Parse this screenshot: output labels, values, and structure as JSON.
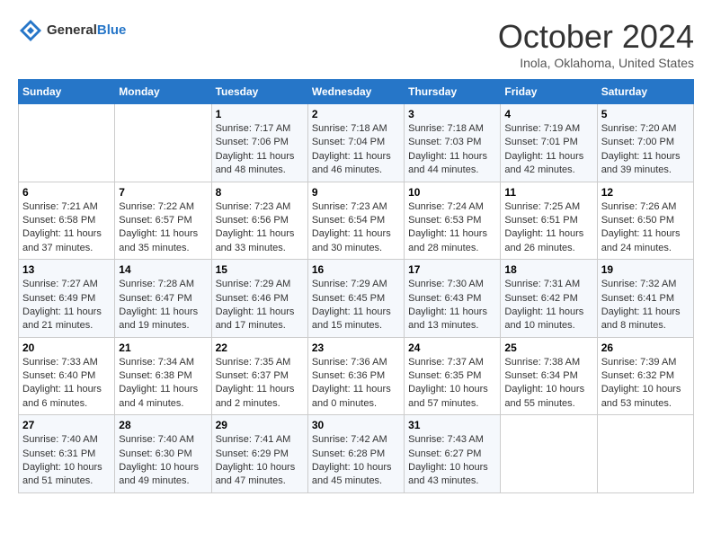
{
  "header": {
    "logo_general": "General",
    "logo_blue": "Blue",
    "month": "October 2024",
    "location": "Inola, Oklahoma, United States"
  },
  "columns": [
    "Sunday",
    "Monday",
    "Tuesday",
    "Wednesday",
    "Thursday",
    "Friday",
    "Saturday"
  ],
  "weeks": [
    [
      {
        "day": "",
        "sunrise": "",
        "sunset": "",
        "daylight": ""
      },
      {
        "day": "",
        "sunrise": "",
        "sunset": "",
        "daylight": ""
      },
      {
        "day": "1",
        "sunrise": "Sunrise: 7:17 AM",
        "sunset": "Sunset: 7:06 PM",
        "daylight": "Daylight: 11 hours and 48 minutes."
      },
      {
        "day": "2",
        "sunrise": "Sunrise: 7:18 AM",
        "sunset": "Sunset: 7:04 PM",
        "daylight": "Daylight: 11 hours and 46 minutes."
      },
      {
        "day": "3",
        "sunrise": "Sunrise: 7:18 AM",
        "sunset": "Sunset: 7:03 PM",
        "daylight": "Daylight: 11 hours and 44 minutes."
      },
      {
        "day": "4",
        "sunrise": "Sunrise: 7:19 AM",
        "sunset": "Sunset: 7:01 PM",
        "daylight": "Daylight: 11 hours and 42 minutes."
      },
      {
        "day": "5",
        "sunrise": "Sunrise: 7:20 AM",
        "sunset": "Sunset: 7:00 PM",
        "daylight": "Daylight: 11 hours and 39 minutes."
      }
    ],
    [
      {
        "day": "6",
        "sunrise": "Sunrise: 7:21 AM",
        "sunset": "Sunset: 6:58 PM",
        "daylight": "Daylight: 11 hours and 37 minutes."
      },
      {
        "day": "7",
        "sunrise": "Sunrise: 7:22 AM",
        "sunset": "Sunset: 6:57 PM",
        "daylight": "Daylight: 11 hours and 35 minutes."
      },
      {
        "day": "8",
        "sunrise": "Sunrise: 7:23 AM",
        "sunset": "Sunset: 6:56 PM",
        "daylight": "Daylight: 11 hours and 33 minutes."
      },
      {
        "day": "9",
        "sunrise": "Sunrise: 7:23 AM",
        "sunset": "Sunset: 6:54 PM",
        "daylight": "Daylight: 11 hours and 30 minutes."
      },
      {
        "day": "10",
        "sunrise": "Sunrise: 7:24 AM",
        "sunset": "Sunset: 6:53 PM",
        "daylight": "Daylight: 11 hours and 28 minutes."
      },
      {
        "day": "11",
        "sunrise": "Sunrise: 7:25 AM",
        "sunset": "Sunset: 6:51 PM",
        "daylight": "Daylight: 11 hours and 26 minutes."
      },
      {
        "day": "12",
        "sunrise": "Sunrise: 7:26 AM",
        "sunset": "Sunset: 6:50 PM",
        "daylight": "Daylight: 11 hours and 24 minutes."
      }
    ],
    [
      {
        "day": "13",
        "sunrise": "Sunrise: 7:27 AM",
        "sunset": "Sunset: 6:49 PM",
        "daylight": "Daylight: 11 hours and 21 minutes."
      },
      {
        "day": "14",
        "sunrise": "Sunrise: 7:28 AM",
        "sunset": "Sunset: 6:47 PM",
        "daylight": "Daylight: 11 hours and 19 minutes."
      },
      {
        "day": "15",
        "sunrise": "Sunrise: 7:29 AM",
        "sunset": "Sunset: 6:46 PM",
        "daylight": "Daylight: 11 hours and 17 minutes."
      },
      {
        "day": "16",
        "sunrise": "Sunrise: 7:29 AM",
        "sunset": "Sunset: 6:45 PM",
        "daylight": "Daylight: 11 hours and 15 minutes."
      },
      {
        "day": "17",
        "sunrise": "Sunrise: 7:30 AM",
        "sunset": "Sunset: 6:43 PM",
        "daylight": "Daylight: 11 hours and 13 minutes."
      },
      {
        "day": "18",
        "sunrise": "Sunrise: 7:31 AM",
        "sunset": "Sunset: 6:42 PM",
        "daylight": "Daylight: 11 hours and 10 minutes."
      },
      {
        "day": "19",
        "sunrise": "Sunrise: 7:32 AM",
        "sunset": "Sunset: 6:41 PM",
        "daylight": "Daylight: 11 hours and 8 minutes."
      }
    ],
    [
      {
        "day": "20",
        "sunrise": "Sunrise: 7:33 AM",
        "sunset": "Sunset: 6:40 PM",
        "daylight": "Daylight: 11 hours and 6 minutes."
      },
      {
        "day": "21",
        "sunrise": "Sunrise: 7:34 AM",
        "sunset": "Sunset: 6:38 PM",
        "daylight": "Daylight: 11 hours and 4 minutes."
      },
      {
        "day": "22",
        "sunrise": "Sunrise: 7:35 AM",
        "sunset": "Sunset: 6:37 PM",
        "daylight": "Daylight: 11 hours and 2 minutes."
      },
      {
        "day": "23",
        "sunrise": "Sunrise: 7:36 AM",
        "sunset": "Sunset: 6:36 PM",
        "daylight": "Daylight: 11 hours and 0 minutes."
      },
      {
        "day": "24",
        "sunrise": "Sunrise: 7:37 AM",
        "sunset": "Sunset: 6:35 PM",
        "daylight": "Daylight: 10 hours and 57 minutes."
      },
      {
        "day": "25",
        "sunrise": "Sunrise: 7:38 AM",
        "sunset": "Sunset: 6:34 PM",
        "daylight": "Daylight: 10 hours and 55 minutes."
      },
      {
        "day": "26",
        "sunrise": "Sunrise: 7:39 AM",
        "sunset": "Sunset: 6:32 PM",
        "daylight": "Daylight: 10 hours and 53 minutes."
      }
    ],
    [
      {
        "day": "27",
        "sunrise": "Sunrise: 7:40 AM",
        "sunset": "Sunset: 6:31 PM",
        "daylight": "Daylight: 10 hours and 51 minutes."
      },
      {
        "day": "28",
        "sunrise": "Sunrise: 7:40 AM",
        "sunset": "Sunset: 6:30 PM",
        "daylight": "Daylight: 10 hours and 49 minutes."
      },
      {
        "day": "29",
        "sunrise": "Sunrise: 7:41 AM",
        "sunset": "Sunset: 6:29 PM",
        "daylight": "Daylight: 10 hours and 47 minutes."
      },
      {
        "day": "30",
        "sunrise": "Sunrise: 7:42 AM",
        "sunset": "Sunset: 6:28 PM",
        "daylight": "Daylight: 10 hours and 45 minutes."
      },
      {
        "day": "31",
        "sunrise": "Sunrise: 7:43 AM",
        "sunset": "Sunset: 6:27 PM",
        "daylight": "Daylight: 10 hours and 43 minutes."
      },
      {
        "day": "",
        "sunrise": "",
        "sunset": "",
        "daylight": ""
      },
      {
        "day": "",
        "sunrise": "",
        "sunset": "",
        "daylight": ""
      }
    ]
  ]
}
